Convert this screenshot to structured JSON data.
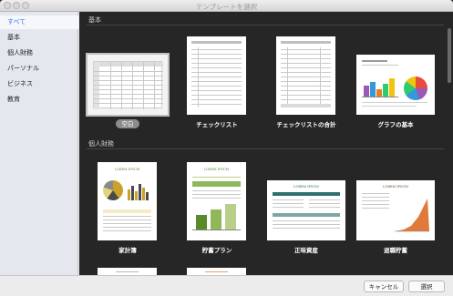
{
  "window": {
    "title": "テンプレートを選択"
  },
  "sidebar": {
    "items": [
      {
        "label": "すべて",
        "selected": true
      },
      {
        "label": "基本",
        "selected": false
      },
      {
        "label": "個人財務",
        "selected": false
      },
      {
        "label": "パーソナル",
        "selected": false
      },
      {
        "label": "ビジネス",
        "selected": false
      },
      {
        "label": "教育",
        "selected": false
      }
    ]
  },
  "sections": [
    {
      "title": "基本",
      "templates": [
        {
          "label": "空白",
          "selected": true
        },
        {
          "label": "チェックリスト",
          "selected": false
        },
        {
          "label": "チェックリストの合計",
          "selected": false
        },
        {
          "label": "グラフの基本",
          "selected": false
        }
      ]
    },
    {
      "title": "個人財務",
      "templates": [
        {
          "label": "家計簿",
          "selected": false
        },
        {
          "label": "貯蓄プラン",
          "selected": false
        },
        {
          "label": "正味資産",
          "selected": false
        },
        {
          "label": "退職貯蓄",
          "selected": false
        }
      ]
    }
  ],
  "thumb_text": {
    "lorem": "LOREM IPSUM"
  },
  "footer": {
    "cancel_label": "キャンセル",
    "select_label": "選択"
  },
  "colors": {
    "accent": "#3478f6",
    "content_bg": "#262626"
  }
}
